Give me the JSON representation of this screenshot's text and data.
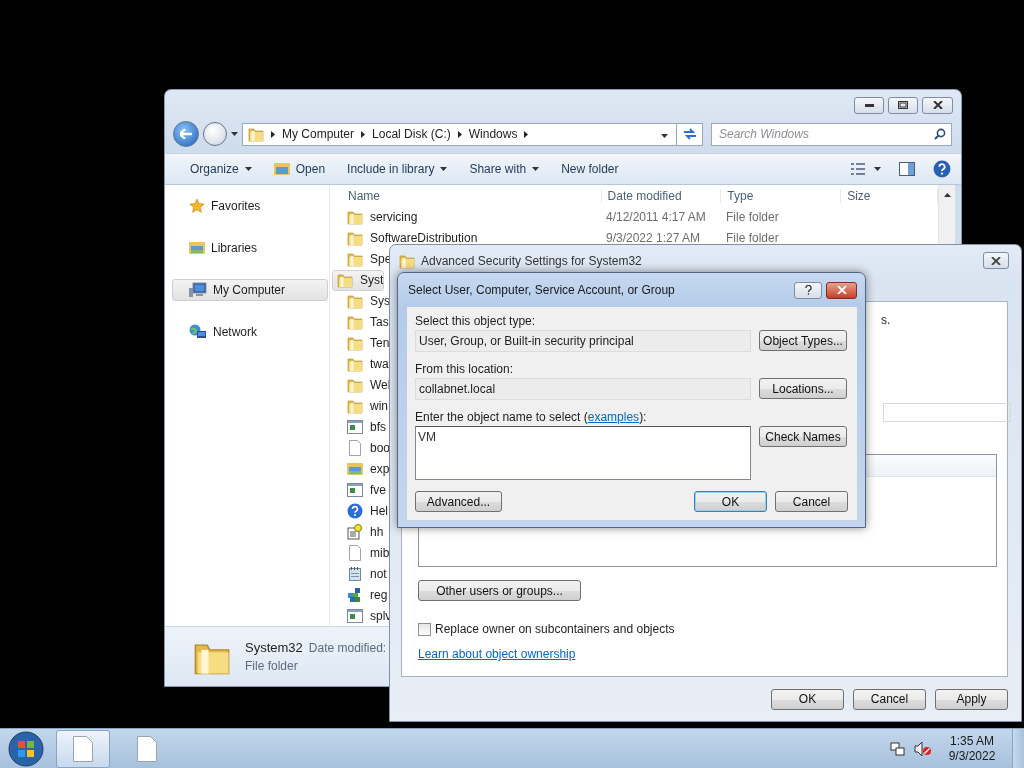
{
  "explorer": {
    "address": [
      "My Computer",
      "Local Disk (C:)",
      "Windows"
    ],
    "search": {
      "placeholder": "Search Windows"
    },
    "toolbar": [
      {
        "label": "Organize",
        "kind": "menu"
      },
      {
        "label": "Open",
        "kind": "open"
      },
      {
        "label": "Include in library",
        "kind": "menu"
      },
      {
        "label": "Share with",
        "kind": "menu"
      },
      {
        "label": "New folder",
        "kind": "plain"
      }
    ],
    "nav": [
      {
        "label": "Favorites",
        "kind": "star",
        "selected": false
      },
      {
        "label": "Libraries",
        "kind": "library",
        "selected": false
      },
      {
        "label": "My Computer",
        "kind": "computer",
        "selected": true
      },
      {
        "label": "Network",
        "kind": "network",
        "selected": false
      }
    ],
    "columns": [
      "Name",
      "Date modified",
      "Type",
      "Size"
    ],
    "files": [
      {
        "name": "servicing",
        "kind": "folder",
        "date": "4/12/2011 4:17 AM",
        "type": "File folder",
        "selected": false
      },
      {
        "name": "SoftwareDistribution",
        "kind": "folder",
        "date": "9/3/2022 1:27 AM",
        "type": "File folder",
        "selected": false
      },
      {
        "name": "Spe",
        "kind": "folder",
        "selected": false
      },
      {
        "name": "Syst",
        "kind": "folder",
        "selected": true
      },
      {
        "name": "Sys",
        "kind": "folder",
        "selected": false
      },
      {
        "name": "Tas",
        "kind": "folder",
        "selected": false
      },
      {
        "name": "Ten",
        "kind": "folder",
        "selected": false
      },
      {
        "name": "twa",
        "kind": "folder",
        "selected": false
      },
      {
        "name": "Wel",
        "kind": "folder",
        "selected": false
      },
      {
        "name": "win",
        "kind": "folder",
        "selected": false
      },
      {
        "name": "bfs",
        "kind": "app",
        "selected": false
      },
      {
        "name": "boo",
        "kind": "doc",
        "selected": false
      },
      {
        "name": "exp",
        "kind": "explorer",
        "selected": false
      },
      {
        "name": "fve",
        "kind": "app",
        "selected": false
      },
      {
        "name": "Hel",
        "kind": "help",
        "selected": false
      },
      {
        "name": "hh",
        "kind": "chm",
        "selected": false
      },
      {
        "name": "mib",
        "kind": "doc",
        "selected": false
      },
      {
        "name": "not",
        "kind": "notepad",
        "selected": false
      },
      {
        "name": "reg",
        "kind": "registry",
        "selected": false
      },
      {
        "name": "splv",
        "kind": "app",
        "selected": false
      }
    ],
    "details": {
      "name": "System32",
      "date_label": "Date modified:",
      "type": "File folder"
    }
  },
  "security_window": {
    "title": "Advanced Security Settings for System32",
    "text_fragment": "s.",
    "other_button": "Other users or groups...",
    "replace_owner": {
      "label": "Replace owner on subcontainers and objects",
      "checked": false
    },
    "link": "Learn about object ownership",
    "buttons": [
      "OK",
      "Cancel",
      "Apply"
    ]
  },
  "select_dialog": {
    "title": "Select User, Computer, Service Account, or Group",
    "object_type": {
      "label": "Select this object type:",
      "value": "User, Group, or Built-in security principal",
      "button": "Object Types..."
    },
    "location": {
      "label": "From this location:",
      "value": "collabnet.local",
      "button": "Locations..."
    },
    "object_name": {
      "label": "Enter the object name to select (",
      "link": "examples",
      "label_end": "):",
      "value": "VM",
      "button": "Check Names"
    },
    "buttons": [
      {
        "label": "Advanced...",
        "default": false
      },
      {
        "label": "OK",
        "default": true
      },
      {
        "label": "Cancel",
        "default": false
      }
    ]
  },
  "taskbar": {
    "buttons": [
      {
        "selected": true
      },
      {
        "selected": false
      }
    ],
    "clock": {
      "time": "1:35 AM",
      "date": "9/3/2022"
    }
  }
}
